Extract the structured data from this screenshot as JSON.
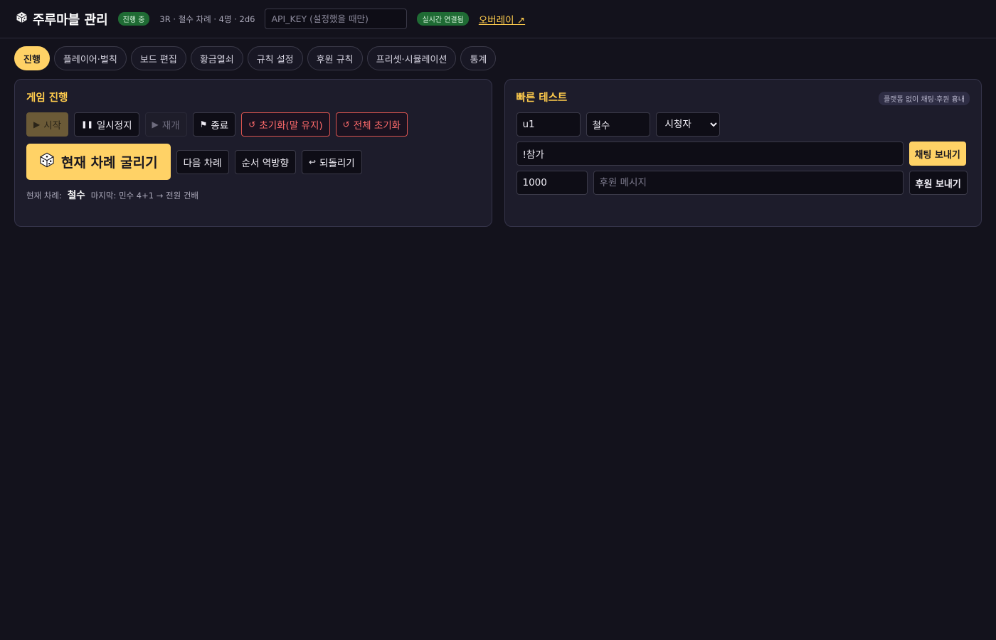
{
  "header": {
    "title": "주루마블 관리",
    "status_badge": "진행 중",
    "meta": "3R · 철수 차례 · 4명 · 2d6",
    "api_key_placeholder": "API_KEY (설정했을 때만)",
    "live_badge": "실시간 연결됨",
    "overlay_link": "오버레이 ↗"
  },
  "tabs": [
    {
      "label": "진행",
      "active": true
    },
    {
      "label": "플레이어·벌칙"
    },
    {
      "label": "보드 편집"
    },
    {
      "label": "황금열쇠"
    },
    {
      "label": "규칙 설정"
    },
    {
      "label": "후원 규칙"
    },
    {
      "label": "프리셋·시뮬레이션"
    },
    {
      "label": "통계"
    }
  ],
  "game": {
    "title": "게임 진행",
    "start": "시작",
    "pause": "일시정지",
    "resume": "재개",
    "end": "종료",
    "reset_keep": "초기화(말 유지)",
    "reset_all": "전체 초기화",
    "roll": "현재 차례 굴리기",
    "next_turn": "다음 차례",
    "reverse": "순서 역방향",
    "undo": "되돌리기",
    "current_label": "현재 차례:",
    "current_player": "철수",
    "last_action": "마지막: 민수 4+1 → 전원 건배"
  },
  "quicktest": {
    "title": "빠른 테스트",
    "hint": "플랫폼 없이 채팅·후원 흉내",
    "user_id": "u1",
    "nickname": "철수",
    "role_selected": "시청자",
    "chat_message": "!참가",
    "send_chat": "채팅 보내기",
    "amount": "1000",
    "donation_placeholder": "후원 메시지",
    "send_donation": "후원 보내기"
  },
  "colors": {
    "accent": "#ffd266",
    "accent_text": "#ffcc4d",
    "badge_green": "#1f6b34",
    "danger": "#ff6b6b",
    "background": "#13121c"
  }
}
